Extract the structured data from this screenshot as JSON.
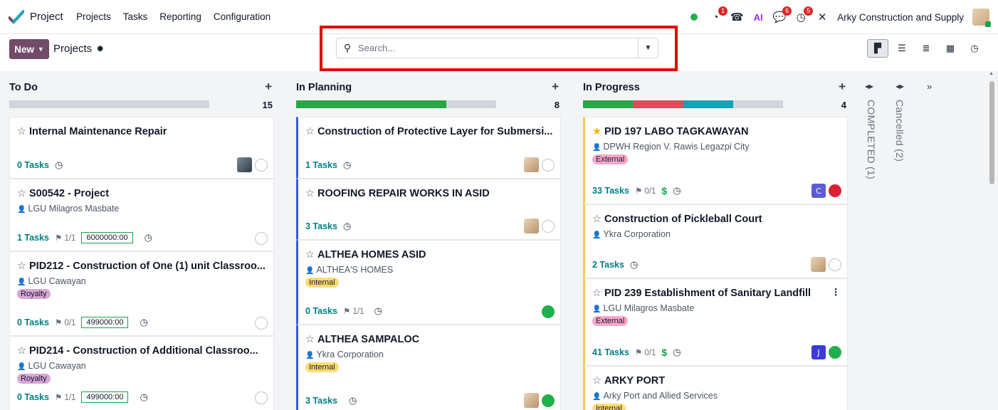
{
  "nav": {
    "app_name": "Project",
    "menu": [
      "Projects",
      "Tasks",
      "Reporting",
      "Configuration"
    ]
  },
  "systray": {
    "activity_badge": "1",
    "ai_label": "AI",
    "messages_badge": "6",
    "clock_badge": "5",
    "company": "Arky Construction and Supply"
  },
  "control": {
    "new_label": "New",
    "breadcrumb": "Projects",
    "search_placeholder": "Search..."
  },
  "colors": {
    "brand": "#714b67",
    "progress_green": "#28a745",
    "progress_red": "#dc4c5a",
    "progress_blue": "#17a2b8",
    "highlight": "#e10600"
  },
  "columns": [
    {
      "title": "To Do",
      "count": "15",
      "progress": [],
      "cards": [
        {
          "title": "Internal Maintenance Repair",
          "tasks": "0 Tasks"
        },
        {
          "title": "S00542 - Project",
          "partner": "LGU Milagros Masbate",
          "tasks": "1 Tasks",
          "milestone": "1/1",
          "amount": "6000000:00"
        },
        {
          "title": "PID212 - Construction of One (1) unit Classroo...",
          "partner": "LGU Cawayan",
          "tag": "Royalty",
          "tasks": "0 Tasks",
          "milestone": "0/1",
          "amount": "499000:00"
        },
        {
          "title": "PID214 - Construction of Additional Classroo...",
          "partner": "LGU Cawayan",
          "tag": "Royalty",
          "tasks": "0 Tasks",
          "milestone": "1/1",
          "amount": "499000:00"
        }
      ]
    },
    {
      "title": "In Planning",
      "count": "8",
      "progress": [
        {
          "color": "green",
          "fraction": 0.75
        }
      ],
      "cards": [
        {
          "title": "Construction of Protective Layer for Submersi...",
          "tasks": "1 Tasks"
        },
        {
          "title": "ROOFING REPAIR WORKS IN ASID",
          "tasks": "3 Tasks"
        },
        {
          "title": "ALTHEA HOMES ASID",
          "partner": "ALTHEA'S HOMES",
          "tag": "Internal",
          "tasks": "0 Tasks",
          "milestone": "1/1"
        },
        {
          "title": "ALTHEA SAMPALOC",
          "partner": "Ykra Corporation",
          "tag": "Internal",
          "tasks": "3 Tasks"
        }
      ]
    },
    {
      "title": "In Progress",
      "count": "4",
      "progress": [
        {
          "color": "green",
          "fraction": 0.25
        },
        {
          "color": "red",
          "fraction": 0.25
        },
        {
          "color": "blue",
          "fraction": 0.25
        }
      ],
      "cards": [
        {
          "title": "PID 197 LABO TAGKAWAYAN",
          "partner": "DPWH Region V. Rawis Legazpi City",
          "tag": "External",
          "tasks": "33 Tasks",
          "milestone": "0/1",
          "avatar_letter": "C"
        },
        {
          "title": "Construction of Pickleball Court",
          "partner": "Ykra Corporation",
          "tasks": "2 Tasks"
        },
        {
          "title": "PID 239 Establishment of Sanitary Landfill",
          "partner": "LGU Milagros Masbate",
          "tag": "External",
          "tasks": "41 Tasks",
          "milestone": "0/1",
          "avatar_letter": "J"
        },
        {
          "title": "ARKY PORT",
          "partner": "Arky Port and Allied Services",
          "tag": "Internal"
        }
      ]
    }
  ],
  "folded_columns": [
    "COMPLETED (1)",
    "Cancelled (2)"
  ]
}
